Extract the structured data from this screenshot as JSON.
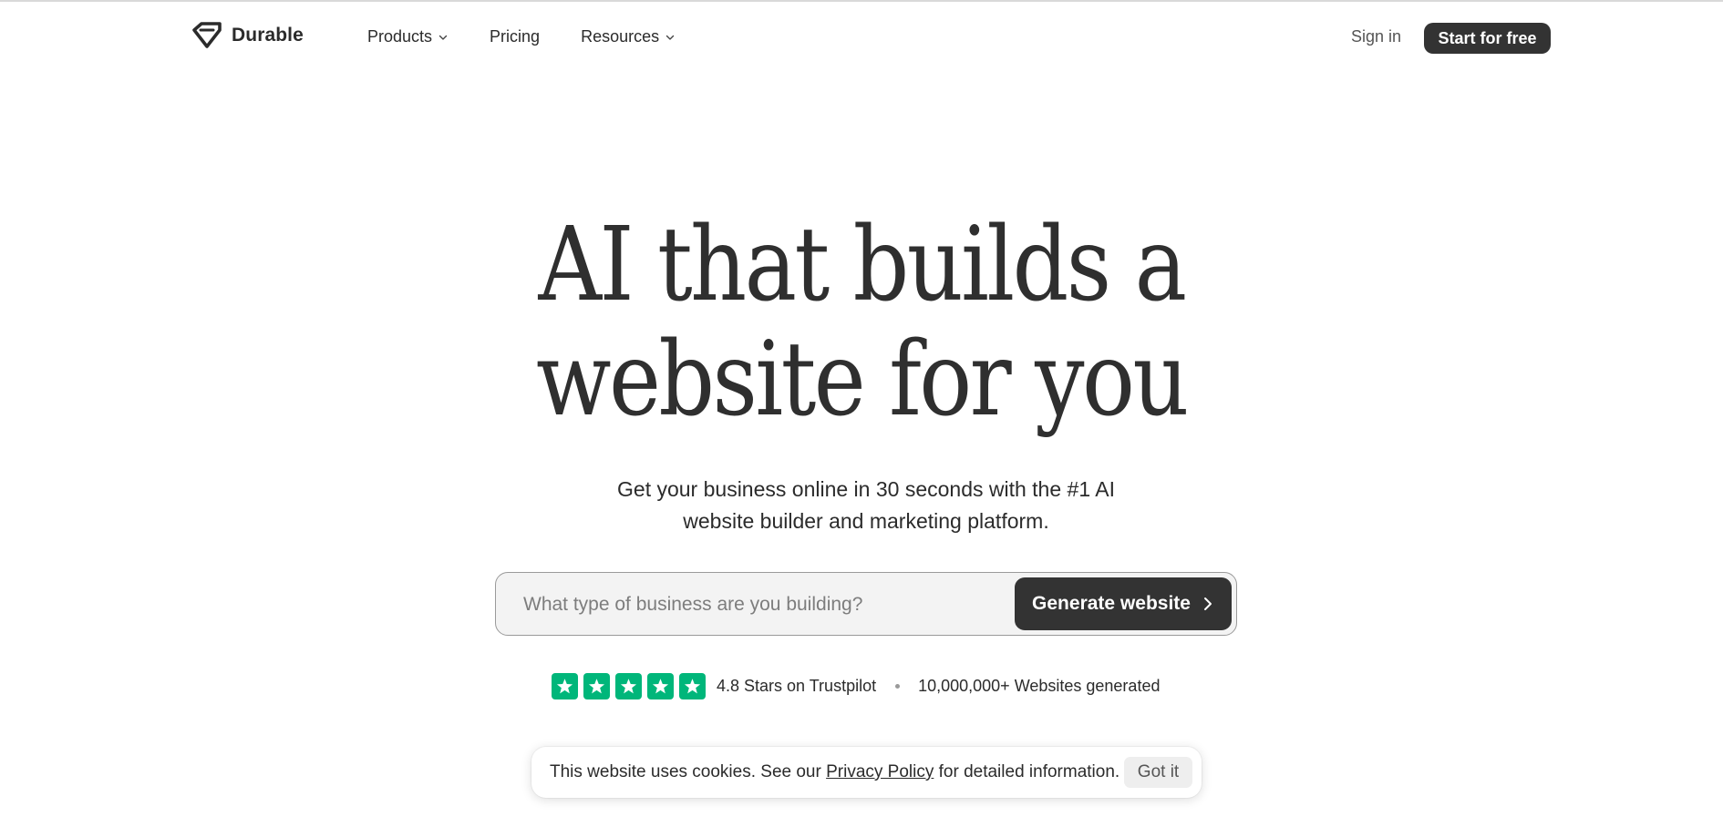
{
  "nav": {
    "brand": "Durable",
    "menu": [
      {
        "label": "Products",
        "has_dropdown": true
      },
      {
        "label": "Pricing",
        "has_dropdown": false
      },
      {
        "label": "Resources",
        "has_dropdown": true
      }
    ],
    "sign_in": "Sign in",
    "cta": "Start for free"
  },
  "hero": {
    "headline_line1": "AI that builds a",
    "headline_line2": "website for you",
    "subtitle": "Get your business online in 30 seconds with the #1 AI website builder and marketing platform."
  },
  "search": {
    "placeholder": "What type of business are you building?",
    "value": "",
    "button_label": "Generate website"
  },
  "rating": {
    "stars": 5,
    "stars_text": "4.8 Stars on Trustpilot",
    "websites_text": "10,000,000+ Websites generated",
    "star_color": "#00b67a"
  },
  "cookie": {
    "text_before": "This website uses cookies. See our ",
    "link": "Privacy Policy",
    "text_after": " for detailed information.",
    "button": "Got it"
  },
  "colors": {
    "primary_dark": "#333333",
    "text": "#2b2b2b"
  },
  "icons": {
    "logo": "diamond-logo-icon",
    "dropdown": "chevron-down-icon",
    "button_arrow": "chevron-right-icon",
    "rating": "star-icon"
  }
}
